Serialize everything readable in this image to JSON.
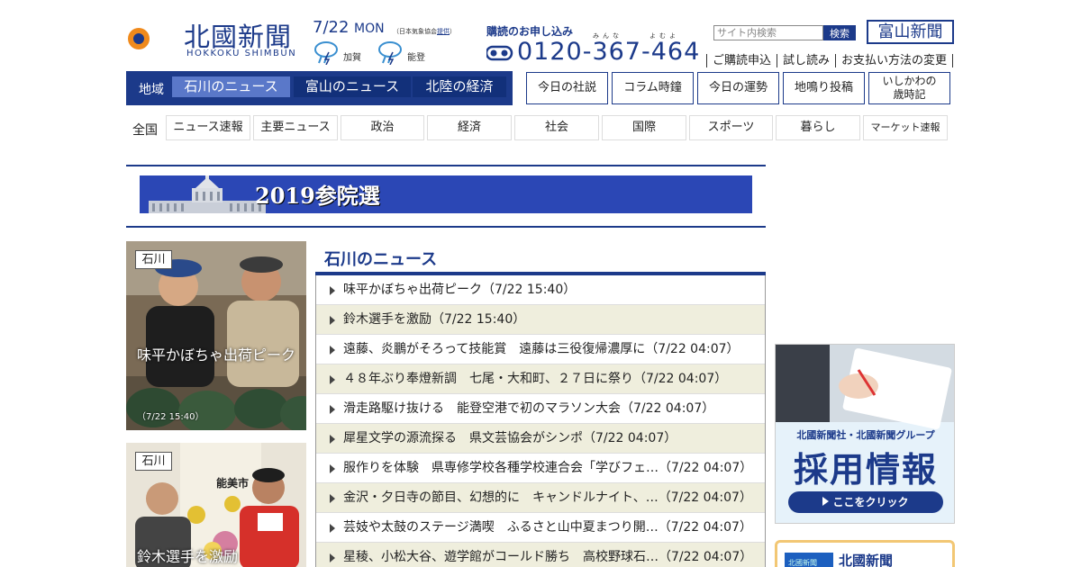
{
  "header": {
    "logo_text": "北國新聞",
    "logo_roman": "HOKKOKU SHIMBUN",
    "date": "7/22",
    "weekday": "MON",
    "weather_source_prefix": "（日本気象協会",
    "weather_source_link": "提供",
    "weather_source_suffix": "）",
    "weather": [
      {
        "region": "加賀",
        "icon": "cloudy-rain-icon"
      },
      {
        "region": "能登",
        "icon": "cloudy-rain-icon"
      }
    ],
    "subscribe_title": "購読のお申し込み",
    "ruby_minna": "みんな",
    "ruby_yomuyo": "よむよ",
    "phone": "0120-367-464",
    "search_placeholder": "サイト内検索",
    "search_button": "検索",
    "toyama_button": "富山新聞",
    "sublinks": [
      "ご購読申込",
      "試し読み",
      "お支払い方法の変更"
    ]
  },
  "region_nav": {
    "label": "地域",
    "tabs": [
      {
        "label": "石川のニュース",
        "active": true
      },
      {
        "label": "富山のニュース",
        "active": false
      },
      {
        "label": "北陸の経済",
        "active": false
      }
    ]
  },
  "column_buttons": [
    "今日の社説",
    "コラム時鐘",
    "今日の運勢",
    "地鳴り投稿"
  ],
  "column_button_two_line": {
    "line1": "いしかわの",
    "line2": "歳時記"
  },
  "category_nav": {
    "all_label": "全国",
    "items": [
      "ニュース速報",
      "主要ニュース",
      "政治",
      "経済",
      "社会",
      "国際",
      "スポーツ",
      "暮らし",
      "マーケット速報"
    ]
  },
  "banner": {
    "text": "2019参院選"
  },
  "photo_cards": [
    {
      "tag": "石川",
      "caption": "味平かぼちゃ出荷ピーク",
      "time": "（7/22 15:40）"
    },
    {
      "tag": "石川",
      "caption": "鈴木選手を激励",
      "sign": "能美市"
    }
  ],
  "news": {
    "title": "石川のニュース",
    "items": [
      "味平かぼちゃ出荷ピーク（7/22 15:40）",
      "鈴木選手を激励（7/22 15:40）",
      "遠藤、炎鵬がそろって技能賞　遠藤は三役復帰濃厚に（7/22 04:07）",
      "４８年ぶり奉燈新調　七尾・大和町、２７日に祭り（7/22 04:07）",
      "滑走路駆け抜ける　能登空港で初のマラソン大会（7/22 04:07）",
      "犀星文学の源流探る　県文芸協会がシンポ（7/22 04:07）",
      "服作りを体験　県専修学校各種学校連合会「学びフェ…（7/22 04:07）",
      "金沢・夕日寺の節目、幻想的に　キャンドルナイト、…（7/22 04:07）",
      "芸妓や太鼓のステージ満喫　ふるさと山中夏まつり開…（7/22 04:07）",
      "星稜、小松大谷、遊学館がコールド勝ち　高校野球石…（7/22 04:07）"
    ]
  },
  "recruit": {
    "subtitle": "北國新聞社・北國新聞グループ",
    "title": "採用情報",
    "button": "ここをクリック"
  },
  "promo": {
    "thumb_text": "北國新聞",
    "name": "北國新聞"
  },
  "colors": {
    "brand": "#1c3a8a",
    "accent": "#5a78c9",
    "row_alt": "#efeedd"
  }
}
